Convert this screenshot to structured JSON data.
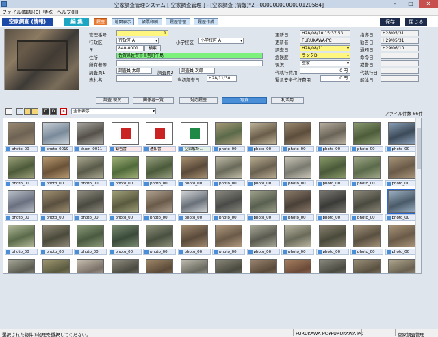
{
  "window": {
    "title": "空家調査管理システム [ 空家調査管理 ] - [空家調査 (情報)*2 - 0000000000000120584]",
    "controls": [
      "–",
      "□",
      "✕"
    ]
  },
  "menu": {
    "items": [
      "ファイル(F)",
      "編集(E)",
      "特殊",
      "ヘルプ(H)"
    ]
  },
  "toolbar": {
    "title": "空家調査 (情報)",
    "edit": "編 集",
    "history": "履歴",
    "map": "地図表示",
    "report": "帳票印刷",
    "hist_manage": "履歴管理",
    "hist_create": "履歴作成",
    "save": "保存",
    "close": "閉じる"
  },
  "form": {
    "mgmt_no_label": "管理番号",
    "mgmt_no": "1",
    "admin_label": "行政区",
    "admin": "行政区 A",
    "school_label": "小学校区",
    "school": "小学校区 A",
    "zip_label": "〒",
    "zip": "840-0001",
    "search_btn": "検索",
    "address_label": "住所",
    "address": "佐賀県佐賀市巨勢町牛島",
    "owner_label": "所有者等",
    "owner": "",
    "inspector1_label": "調査員1",
    "inspector1": "調査員 太郎",
    "inspector2_label": "調査員2",
    "inspector2": "調査員 次郎",
    "sign_label": "表札名",
    "sign": "",
    "first_date_label": "当初調査日",
    "first_date": "H28/11/30"
  },
  "status": {
    "updated_label": "更新日",
    "updated": "H28/08/10 15:37:53",
    "updater_label": "更新者",
    "updater": "FURUKAWA-PC",
    "survey_date_label": "調査日",
    "survey_date": "H28/08/11",
    "danger_label": "危険度",
    "danger": "ランクD",
    "state_label": "現況",
    "state": "空家",
    "proxy_cost_label": "代執行費用",
    "proxy_cost": "0 円",
    "emergency_cost_label": "緊急安全代行費用",
    "emergency_cost": "0 円"
  },
  "dates": {
    "guide_label": "指導日",
    "guide": "H28/05/31",
    "advice_label": "勧告日",
    "advice": "H29/05/31",
    "notice_label": "通知日",
    "notice": "H29/06/10",
    "order_label": "命令日",
    "order": "",
    "warn_label": "戒告日",
    "warn": "",
    "exec_label": "代執行日",
    "exec": "",
    "demolish_label": "解体日",
    "demolish": ""
  },
  "tabs": [
    "調査 現況",
    "関係者一覧",
    "対応履歴",
    "写真",
    "利活用"
  ],
  "gallery": {
    "filter": "全件表示",
    "file_count": "ファイル件数 66件",
    "items": [
      {
        "cap": "photo_00",
        "kind": "photo",
        "c1": "#6d6254",
        "c2": "#9a8a72"
      },
      {
        "cap": "photo_0019",
        "kind": "photo",
        "c1": "#7a8a9a",
        "c2": "#c8d0d8"
      },
      {
        "cap": "thum_0011",
        "kind": "photo",
        "c1": "#55504a",
        "c2": "#a8a6a0"
      },
      {
        "cap": "勧告書",
        "kind": "pdf"
      },
      {
        "cap": "通知書",
        "kind": "pdf"
      },
      {
        "cap": "空家解計...",
        "kind": "xls"
      },
      {
        "cap": "photo_00",
        "kind": "photo",
        "c1": "#5b6a4a",
        "c2": "#a89a78"
      },
      {
        "cap": "photo_00",
        "kind": "photo",
        "c1": "#6a5d4a",
        "c2": "#bfb39a"
      },
      {
        "cap": "photo_00",
        "kind": "photo",
        "c1": "#5c4d3c",
        "c2": "#9c8a70"
      },
      {
        "cap": "photo_00",
        "kind": "photo",
        "c1": "#6a6458",
        "c2": "#b8b0a0"
      },
      {
        "cap": "photo_00",
        "kind": "photo",
        "c1": "#4d5c3a",
        "c2": "#8a9a70"
      },
      {
        "cap": "photo_00",
        "kind": "photo",
        "c1": "#3c4a58",
        "c2": "#8aa0b8"
      },
      {
        "cap": "photo_00",
        "kind": "photo",
        "c1": "#4d5a3a",
        "c2": "#9aa078"
      },
      {
        "cap": "photo_00",
        "kind": "photo",
        "c1": "#6a5238",
        "c2": "#b89a70"
      },
      {
        "cap": "photo_00",
        "kind": "photo",
        "c1": "#5a5a4a",
        "c2": "#a8a890"
      },
      {
        "cap": "photo_00",
        "kind": "photo",
        "c1": "#506a3a",
        "c2": "#a0b078"
      },
      {
        "cap": "photo_00",
        "kind": "photo",
        "c1": "#4a5a3a",
        "c2": "#98a080"
      },
      {
        "cap": "photo_00",
        "kind": "photo",
        "c1": "#5a4a3a",
        "c2": "#a89070"
      },
      {
        "cap": "photo_00",
        "kind": "photo",
        "c1": "#6a6a5a",
        "c2": "#c0bca8"
      },
      {
        "cap": "photo_00",
        "kind": "photo",
        "c1": "#6a6050",
        "c2": "#b8ac90"
      },
      {
        "cap": "photo_00",
        "kind": "photo",
        "c1": "#7a7a70",
        "c2": "#cac6b8"
      },
      {
        "cap": "photo_00",
        "kind": "photo",
        "c1": "#4a5a3a",
        "c2": "#8a9a68"
      },
      {
        "cap": "photo_00",
        "kind": "photo",
        "c1": "#5a6a4a",
        "c2": "#a0a888"
      },
      {
        "cap": "photo_00",
        "kind": "photo",
        "c1": "#6a5a48",
        "c2": "#a89478"
      },
      {
        "cap": "photo_00",
        "kind": "photo",
        "c1": "#6a7080",
        "c2": "#b8c0c8"
      },
      {
        "cap": "photo_00",
        "kind": "photo",
        "c1": "#5a5040",
        "c2": "#a09070"
      },
      {
        "cap": "photo_00",
        "kind": "photo",
        "c1": "#4a4a40",
        "c2": "#908c80"
      },
      {
        "cap": "photo_00",
        "kind": "photo",
        "c1": "#5a5a40",
        "c2": "#a0a078"
      },
      {
        "cap": "photo_00",
        "kind": "photo",
        "c1": "#6a5a4a",
        "c2": "#b0a090"
      },
      {
        "cap": "photo_00",
        "kind": "photo",
        "c1": "#6a7078",
        "c2": "#d0d4d8"
      },
      {
        "cap": "photo_00",
        "kind": "photo",
        "c1": "#4a4a48",
        "c2": "#8a8a80"
      },
      {
        "cap": "photo_00",
        "kind": "photo",
        "c1": "#5a6050",
        "c2": "#9aa088"
      },
      {
        "cap": "photo_00",
        "kind": "photo",
        "c1": "#4a4038",
        "c2": "#8a7a68"
      },
      {
        "cap": "photo_00",
        "kind": "photo",
        "c1": "#3a3a38",
        "c2": "#7a7870"
      },
      {
        "cap": "photo_00",
        "kind": "photo",
        "c1": "#4a4a40",
        "c2": "#8c8878"
      },
      {
        "cap": "photo_00",
        "kind": "photo",
        "c1": "#4a5a68",
        "c2": "#9ab0c4"
      },
      {
        "cap": "photo_00",
        "kind": "photo",
        "c1": "#5a6a4a",
        "c2": "#b0b898"
      },
      {
        "cap": "photo_00",
        "kind": "photo",
        "c1": "#4a4a3a",
        "c2": "#908878"
      },
      {
        "cap": "photo_00",
        "kind": "photo",
        "c1": "#4a5a40",
        "c2": "#8a9a78"
      },
      {
        "cap": "photo_00",
        "kind": "photo",
        "c1": "#3a4a3a",
        "c2": "#788a70"
      },
      {
        "cap": "photo_00",
        "kind": "photo",
        "c1": "#4a5040",
        "c2": "#8a9078"
      },
      {
        "cap": "photo_00",
        "kind": "photo",
        "c1": "#5a4a3a",
        "c2": "#a08a70"
      },
      {
        "cap": "photo_00",
        "kind": "photo",
        "c1": "#6a5a48",
        "c2": "#b09a80"
      },
      {
        "cap": "photo_00",
        "kind": "photo",
        "c1": "#5a5a50",
        "c2": "#a8a898"
      },
      {
        "cap": "photo_00",
        "kind": "photo",
        "c1": "#6a6a5a",
        "c2": "#b8b4a0"
      },
      {
        "cap": "photo_00",
        "kind": "photo",
        "c1": "#4a4a3a",
        "c2": "#888070"
      },
      {
        "cap": "photo_00",
        "kind": "photo",
        "c1": "#5a5040",
        "c2": "#a09078"
      },
      {
        "cap": "photo_00",
        "kind": "photo",
        "c1": "#6a5a48",
        "c2": "#a89478"
      },
      {
        "cap": "photo_00",
        "kind": "photo",
        "c1": "#5a5a50",
        "c2": "#a8a898"
      },
      {
        "cap": "photo_00",
        "kind": "photo",
        "c1": "#5a5a40",
        "c2": "#a09870"
      },
      {
        "cap": "photo_00",
        "kind": "photo",
        "c1": "#7a7068",
        "c2": "#c8c0b0"
      },
      {
        "cap": "photo_00",
        "kind": "photo",
        "c1": "#4a4a40",
        "c2": "#908c80"
      },
      {
        "cap": "photo_00",
        "kind": "photo",
        "c1": "#5a4a38",
        "c2": "#a08868"
      },
      {
        "cap": "photo_00",
        "kind": "photo",
        "c1": "#6a6a60",
        "c2": "#c0bcb0"
      },
      {
        "cap": "photo_00",
        "kind": "photo",
        "c1": "#4a4a40",
        "c2": "#8a8878"
      },
      {
        "cap": "photo_00",
        "kind": "photo",
        "c1": "#5a4a3a",
        "c2": "#9a8470"
      },
      {
        "cap": "photo_00",
        "kind": "photo",
        "c1": "#6a4a38",
        "c2": "#a88060"
      },
      {
        "cap": "photo_00",
        "kind": "photo",
        "c1": "#4a4a40",
        "c2": "#8a8a80"
      },
      {
        "cap": "photo_00",
        "kind": "photo",
        "c1": "#5a5040",
        "c2": "#9a9078"
      },
      {
        "cap": "photo_00",
        "kind": "photo",
        "c1": "#6a6050",
        "c2": "#b0a890"
      }
    ],
    "selected_index": 35
  },
  "statusbar": {
    "message": "選択された物件の処理を選択してください。",
    "host": "FURUKAWA-PC¥FURUKAWA-PC",
    "system": "空家調査管理"
  }
}
